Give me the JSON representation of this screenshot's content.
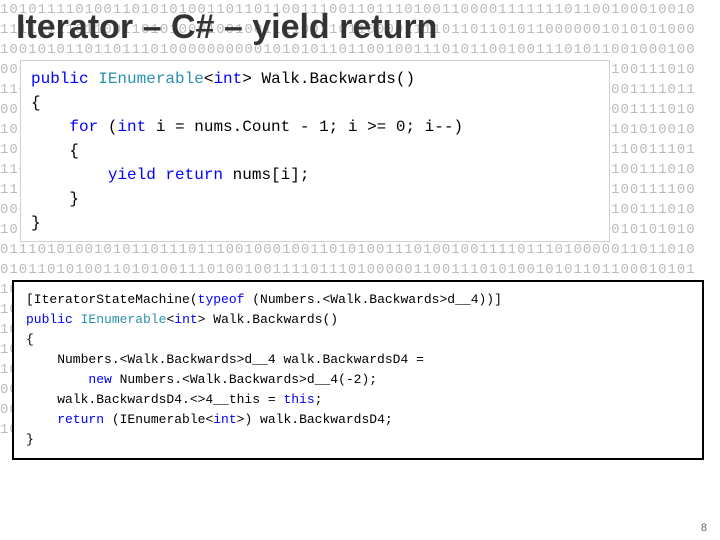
{
  "title": "Iterator – C# – yield return",
  "page_number": "8",
  "background_binary": "10101111010011010101001101101100111001101110100110000111111101100100010010\n11111111011001101010001001001111001101100001111011011010110000001010101000\n10010101101101110100000000001010101101100100111010110010011101011001000100\n00000111011001101001110101100100111010010011000111101101110101100100111010\n11011000001111100101001001011001001110101001010110110111010000011001111011\n00101001001110101001011110111011010010010110010011100111010000011001111010\n10110110001110101001010110110111010000000001010101110100000110011101010010\n10110111010000000001010101101100100110111010010011110111010001010110011101\n11001000100101001110101001010110110111010000000001010101110000101100111010\n11100000110011101010010101101101110100000000010101011101110100101100111100\n00010110110010011101000001000001100111010100101011001001110110001100111010\n10101010101010101010101010101010101010101010101010101010101010101010101010\n01110101001010110111011100100010011010100111010010011110111010000011011010\n01011010100110101001110100100111101110100000110011101010010101101100010101\n10110010011101010010101101101110100000000010101011101000001100110100111010\n10011101010010101101101110100000000010101011101000001100111010100100111010\n10101101100001010110011101010010101101101110100000000010101011100100111010\n10101101101110100000000010101011101000001100110101001110100100111101010010\n10100111010010011110111010000011001110101001010110110111010000000001010101\n00110101001110100100111101110100000110011101010010101101101110100000010100\n00001011101111110111110111110101110111000111010011011110001010010101100101\n10111011010111001000000011000100011101011001101001111101101000110011001010",
  "code_top": {
    "line1": {
      "kw": "public",
      "type": "IEnumerable",
      "gen": "int",
      "method": "Walk.Backwards()"
    },
    "line2": "{",
    "line3": {
      "kw": "for",
      "content": " (",
      "kw2": "int",
      "rest": " i = nums.Count - 1; i >= 0; i--)"
    },
    "line4": "    {",
    "line5": {
      "kw": "yield return",
      "rest": " nums[i];"
    },
    "line6": "    }",
    "line7": "}"
  },
  "code_bottom": {
    "line1": {
      "attr_open": "[IteratorStateMachine(",
      "kw": "typeof",
      "rest": " (Numbers.<Walk.Backwards>d__4))]"
    },
    "line2": {
      "kw": "public",
      "type": "IEnumerable",
      "gen": "int",
      "method": "Walk.Backwards()"
    },
    "line3": "{",
    "line4": "    Numbers.<Walk.Backwards>d__4 walk.BackwardsD4 =",
    "line5": {
      "kw": "new",
      "rest": " Numbers.<Walk.Backwards>d__4(-2);"
    },
    "line6": {
      "left": "    walk.BackwardsD4.<>4__this = ",
      "kw": "this",
      "semi": ";"
    },
    "line7": {
      "kw": "return",
      "rest": " (IEnumerable<",
      "kw2": "int",
      "rest2": ">) walk.BackwardsD4;"
    },
    "line8": "}"
  }
}
